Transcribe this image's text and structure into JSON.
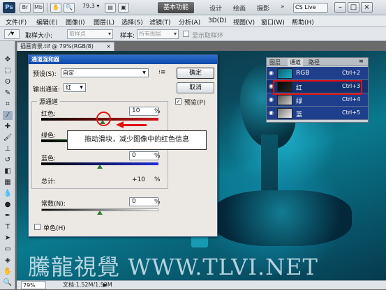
{
  "titlebar": {
    "logo": "Ps",
    "zoom": "79.3",
    "workspace": "基本功能",
    "workspaces": [
      "设计",
      "绘画",
      "摄影"
    ],
    "more": "»",
    "cslive": "CS Live",
    "min": "–",
    "max": "□",
    "close": "×"
  },
  "menu": [
    "文件(F)",
    "编辑(E)",
    "图像(I)",
    "图层(L)",
    "选择(S)",
    "滤镜(T)",
    "分析(A)",
    "3D(D)",
    "视图(V)",
    "窗口(W)",
    "帮助(H)"
  ],
  "options": {
    "size_label": "取样大小:",
    "size_value": "取样点",
    "sample_label": "样本:",
    "sample_value": "所有图层",
    "show_ring": "显示取样环"
  },
  "document": {
    "tab": "插画背景.tif @ 79%(RGB/8)",
    "tab_close": "×",
    "zoom": "79%",
    "doc_info": "文档:1.52M/1.52M"
  },
  "dialog": {
    "title": "通道混和器",
    "preset_label": "预设(S):",
    "preset_value": "自定",
    "output_label": "输出通道:",
    "output_value": "红",
    "ok": "确定",
    "cancel": "取消",
    "preview": "预览(P)",
    "source_group": "源通道",
    "red_label": "红色:",
    "red_value": 10,
    "green_label": "绿色:",
    "green_value": "0",
    "blue_label": "蓝色:",
    "blue_value": "0",
    "percent": "%",
    "total_label": "总计:",
    "total_value": "+10",
    "const_label": "常数(N):",
    "const_value": "0",
    "mono": "单色(H)"
  },
  "callout": {
    "text": "拖动滑块，减少图像中的红色信息"
  },
  "channels": {
    "tabs": [
      "图层",
      "通道",
      "路径"
    ],
    "rows": [
      {
        "name": "RGB",
        "key": "Ctrl+2"
      },
      {
        "name": "红",
        "key": "Ctrl+3"
      },
      {
        "name": "绿",
        "key": "Ctrl+4"
      },
      {
        "name": "蓝",
        "key": "Ctrl+5"
      }
    ]
  },
  "watermark": "騰龍視覺 WWW.TLVI.NET",
  "colors": {
    "accent_red": "#e01010",
    "selection_blue": "#1f3f8c"
  }
}
